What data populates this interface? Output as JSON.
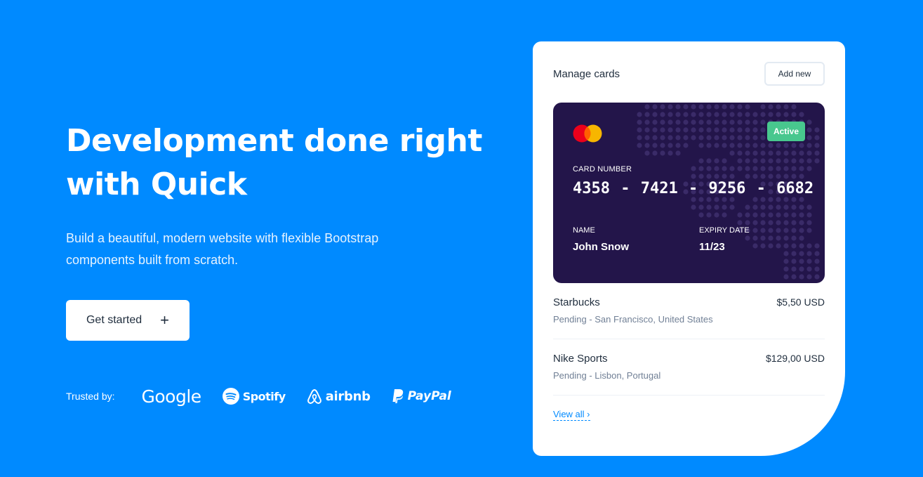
{
  "hero": {
    "title_line1": "Development done right",
    "title_line2": "with Quick",
    "subtitle_line1": "Build a beautiful, modern website with flexible Bootstrap",
    "subtitle_line2": "components built from scratch.",
    "cta_label": "Get started",
    "cta_icon": "plus-icon"
  },
  "trusted": {
    "label": "Trusted by:",
    "logos": [
      "Google",
      "Spotify",
      "airbnb",
      "PayPal"
    ]
  },
  "panel": {
    "title": "Manage cards",
    "add_label": "Add new",
    "card": {
      "brand_icon": "mastercard-icon",
      "status": "Active",
      "number_label": "CARD NUMBER",
      "number": "4358  -  7421  -  9256  -  6682",
      "name_label": "NAME",
      "name": "John Snow",
      "expiry_label": "EXPIRY DATE",
      "expiry": "11/23"
    },
    "transactions": [
      {
        "merchant": "Starbucks",
        "detail": "Pending - San Francisco, United States",
        "amount": "$5,50 USD"
      },
      {
        "merchant": "Nike Sports",
        "detail": "Pending - Lisbon, Portugal",
        "amount": "$129,00 USD"
      }
    ],
    "view_all": "View all ›"
  },
  "colors": {
    "background": "#008AFF",
    "card": "#23154A",
    "active_badge": "#48C78E",
    "link": "#008AFF"
  }
}
